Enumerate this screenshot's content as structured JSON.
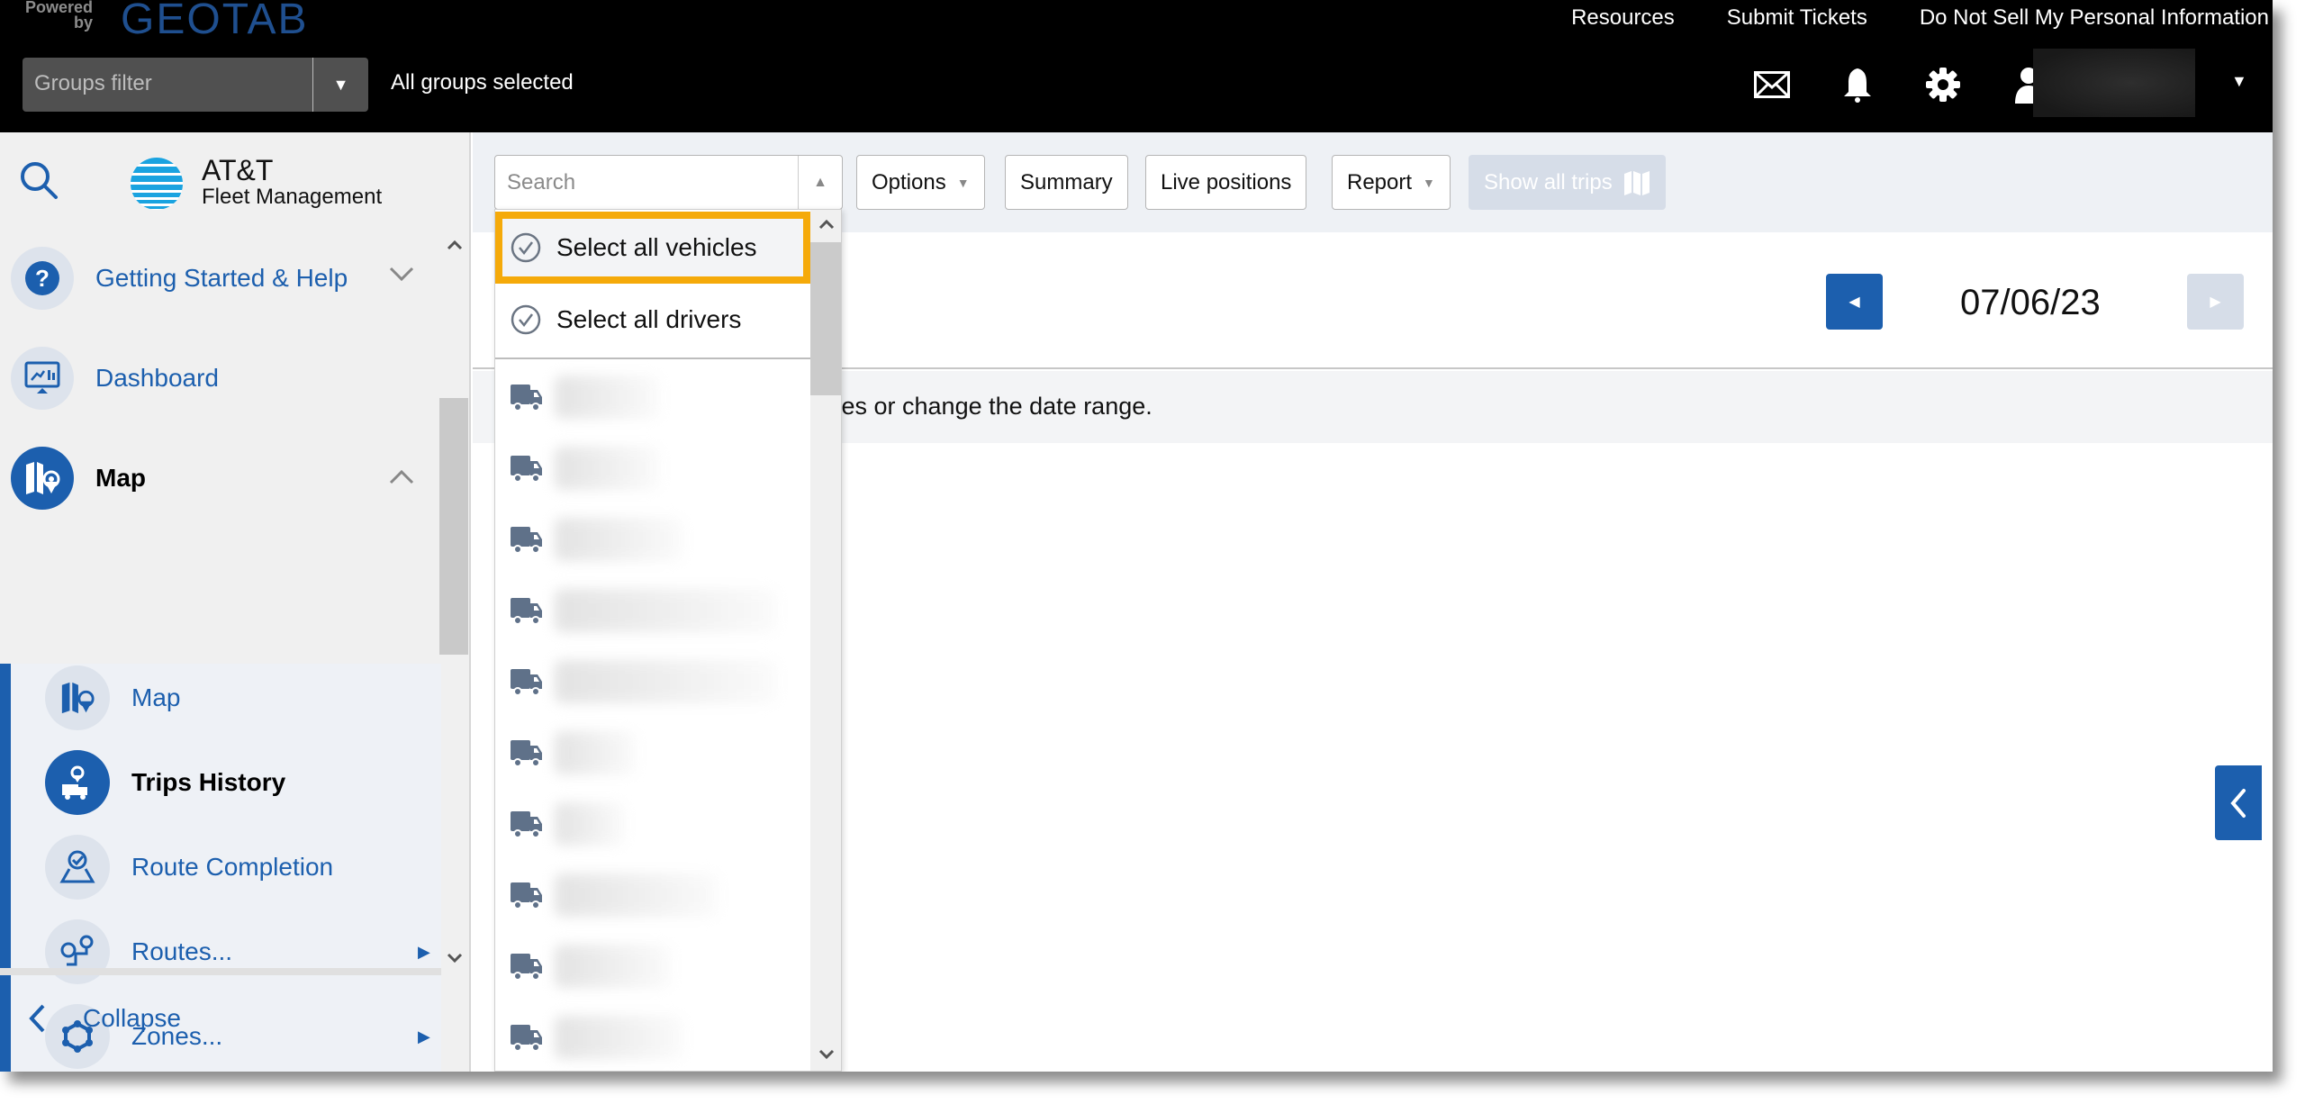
{
  "header": {
    "powered_by": "Powered by",
    "brand": "GEOTAB",
    "links": [
      "Resources",
      "Submit Tickets",
      "Do Not Sell My Personal Information"
    ],
    "groups_filter_placeholder": "Groups filter",
    "groups_selected": "All groups selected",
    "icons": [
      "mail-icon",
      "bell-icon",
      "gear-icon",
      "user-icon"
    ]
  },
  "sidebar": {
    "brand_line1": "AT&T",
    "brand_line2": "Fleet Management",
    "items": [
      {
        "label": "Getting Started & Help",
        "icon": "help-icon",
        "expanded": false
      },
      {
        "label": "Dashboard",
        "icon": "dashboard-icon"
      },
      {
        "label": "Map",
        "icon": "map-icon",
        "expanded": true,
        "active_section": true
      }
    ],
    "subitems": [
      {
        "label": "Map",
        "icon": "map-icon"
      },
      {
        "label": "Trips History",
        "icon": "trips-history-icon",
        "active": true
      },
      {
        "label": "Route Completion",
        "icon": "route-completion-icon"
      },
      {
        "label": "Routes...",
        "icon": "routes-icon",
        "has_submenu": true
      },
      {
        "label": "Zones...",
        "icon": "zones-icon",
        "has_submenu": true
      }
    ],
    "collapse_label": "Collapse"
  },
  "toolbar": {
    "search_placeholder": "Search",
    "options_label": "Options",
    "summary_label": "Summary",
    "live_positions_label": "Live positions",
    "report_label": "Report",
    "show_all_trips_label": "Show all trips"
  },
  "dropdown": {
    "select_all_vehicles": "Select all vehicles",
    "select_all_drivers": "Select all drivers",
    "vehicle_count_visible": 10
  },
  "main": {
    "date": "07/06/23",
    "message": "ices or change the date range."
  },
  "colors": {
    "accent": "#1c5fae",
    "highlight": "#f5aa0a",
    "header_bg": "#000000"
  }
}
